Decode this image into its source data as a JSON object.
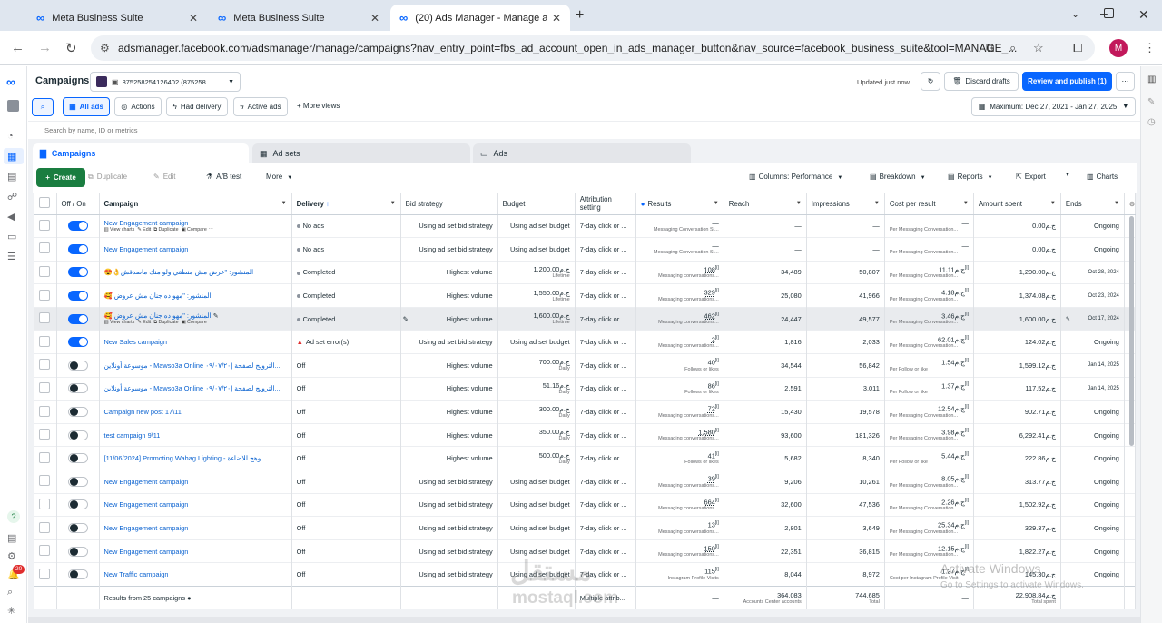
{
  "browser": {
    "tabs": [
      {
        "title": "Meta Business Suite"
      },
      {
        "title": "Meta Business Suite"
      },
      {
        "title": "(20) Ads Manager - Manage ad"
      }
    ],
    "url": "adsmanager.facebook.com/adsmanager/manage/campaigns?nav_entry_point=fbs_ad_account_open_in_ads_manager_button&nav_source=facebook_business_suite&tool=MANAGE_...",
    "profile_initial": "M"
  },
  "rail": {
    "badge": "20"
  },
  "header": {
    "title": "Campaigns",
    "account_label": "875258254126402 (875258...",
    "updated_text": "Updated just now",
    "discard_label": "Discard drafts",
    "review_label": "Review and publish (1)",
    "more_label": "⋯"
  },
  "filters": {
    "all_ads": "All ads",
    "actions": "Actions",
    "had_delivery": "Had delivery",
    "active_ads": "Active ads",
    "more_views": "More views",
    "date_range": "Maximum: Dec 27, 2021 - Jan 27, 2025",
    "search_placeholder": "Search by name, ID or metrics"
  },
  "level_tabs": {
    "campaigns": "Campaigns",
    "ad_sets": "Ad sets",
    "ads": "Ads"
  },
  "toolbar": {
    "create": "Create",
    "duplicate": "Duplicate",
    "edit": "Edit",
    "ab_test": "A/B test",
    "more": "More",
    "columns": "Columns: Performance",
    "breakdown": "Breakdown",
    "reports": "Reports",
    "export": "Export",
    "charts": "Charts"
  },
  "columns": {
    "onoff": "Off / On",
    "campaign": "Campaign",
    "delivery": "Delivery",
    "bid": "Bid strategy",
    "budget": "Budget",
    "attribution": "Attribution setting",
    "results": "Results",
    "reach": "Reach",
    "impressions": "Impressions",
    "cpr": "Cost per result",
    "spent": "Amount spent",
    "ends": "Ends"
  },
  "row_actions": {
    "charts": "View charts",
    "edit": "Edit",
    "duplicate": "Duplicate",
    "compare": "Compare"
  },
  "rows": [
    {
      "on": true,
      "name": "New Engagement campaign",
      "delivery": "No ads",
      "delivery_status": "none",
      "bid": "Using ad set bid strategy",
      "budget": "Using ad set budget",
      "budget_sub": "",
      "attr": "7-day click or ...",
      "results": "—",
      "results_sub": "Messaging Conversation St...",
      "reach": "—",
      "impr": "—",
      "cpr": "—",
      "cpr_sub": "Per Messaging Conversation...",
      "spent": "ج.م0.00",
      "ends": "Ongoing",
      "hover": true
    },
    {
      "on": true,
      "name": "New Engagement campaign",
      "delivery": "No ads",
      "delivery_status": "none",
      "bid": "Using ad set bid strategy",
      "budget": "Using ad set budget",
      "budget_sub": "",
      "attr": "7-day click or ...",
      "results": "—",
      "results_sub": "Messaging Conversation St...",
      "reach": "—",
      "impr": "—",
      "cpr": "—",
      "cpr_sub": "Per Messaging Conversation...",
      "spent": "ج.م0.00",
      "ends": "Ongoing"
    },
    {
      "on": true,
      "name": "😍👌المنشور: \"عرض مش منطقي ولو منك ماصدقش",
      "delivery": "Completed",
      "delivery_status": "done",
      "bid": "Highest volume",
      "budget": "ج.م1,200.00",
      "budget_sub": "Lifetime",
      "attr": "7-day click or ...",
      "results": "108",
      "results_sub": "Messaging conversations...",
      "reach": "34,489",
      "impr": "50,807",
      "cpr": "ج.م11.11",
      "cpr_sub": "Per Messaging Conversation...",
      "spent": "ج.م1,200.00",
      "ends": "Oct 28, 2024"
    },
    {
      "on": true,
      "name": "🥰 المنشور: \"مهو ده جنان مش عروض",
      "delivery": "Completed",
      "delivery_status": "done",
      "bid": "Highest volume",
      "budget": "ج.م1,550.00",
      "budget_sub": "Lifetime",
      "attr": "7-day click or ...",
      "results": "329",
      "results_sub": "Messaging conversations...",
      "reach": "25,080",
      "impr": "41,966",
      "cpr": "ج.م4.18",
      "cpr_sub": "Per Messaging Conversation...",
      "spent": "ج.م1,374.08",
      "ends": "Oct 23, 2024"
    },
    {
      "on": true,
      "name": "🥰 المنشور: \"مهو ده جنان مش عروض",
      "delivery": "Completed",
      "delivery_status": "done",
      "bid": "Highest volume",
      "budget": "ج.م1,600.00",
      "budget_sub": "Lifetime",
      "attr": "7-day click or ...",
      "results": "462",
      "results_sub": "Messaging conversations...",
      "reach": "24,447",
      "impr": "49,577",
      "cpr": "ج.م3.46",
      "cpr_sub": "Per Messaging Conversation...",
      "spent": "ج.م1,600.00",
      "ends": "Oct 17, 2024",
      "hover": true,
      "selected": true
    },
    {
      "on": true,
      "name": "New Sales campaign",
      "delivery": "Ad set error(s)",
      "delivery_status": "error",
      "bid": "Using ad set bid strategy",
      "budget": "Using ad set budget",
      "budget_sub": "",
      "attr": "7-day click or ...",
      "results": "2",
      "results_sub": "Messaging conversations...",
      "reach": "1,816",
      "impr": "2,033",
      "cpr": "ج.م62.01",
      "cpr_sub": "Per Messaging Conversation...",
      "spent": "ج.م124.02",
      "ends": "Ongoing"
    },
    {
      "on": false,
      "name": "موسوعة أونلاين - Mawso3a Online الترويج لصفحة [٠٩/٠٧/٢٠...",
      "delivery": "Off",
      "delivery_status": "off",
      "bid": "Highest volume",
      "budget": "ج.م700.00",
      "budget_sub": "Daily",
      "attr": "7-day click or ...",
      "results": "40",
      "results_sub": "Follows or likes",
      "reach": "34,544",
      "impr": "56,842",
      "cpr": "ج.م1.54",
      "cpr_sub": "Per Follow or like",
      "spent": "ج.م1,599.12",
      "ends": "Jan 14, 2025"
    },
    {
      "on": false,
      "name": "موسوعة أونلاين - Mawso3a Online الترويج لصفحة [٠٩/٠٧/٢٠...",
      "delivery": "Off",
      "delivery_status": "off",
      "bid": "Highest volume",
      "budget": "ج.م51.16",
      "budget_sub": "Daily",
      "attr": "7-day click or ...",
      "results": "86",
      "results_sub": "Follows or likes",
      "reach": "2,591",
      "impr": "3,011",
      "cpr": "ج.م1.37",
      "cpr_sub": "Per Follow or like",
      "spent": "ج.م117.52",
      "ends": "Jan 14, 2025"
    },
    {
      "on": false,
      "name": "Campaign new post 17\\11",
      "delivery": "Off",
      "delivery_status": "off",
      "bid": "Highest volume",
      "budget": "ج.م300.00",
      "budget_sub": "Daily",
      "attr": "7-day click or ...",
      "results": "72",
      "results_sub": "Messaging conversations...",
      "reach": "15,430",
      "impr": "19,578",
      "cpr": "ج.م12.54",
      "cpr_sub": "Per Messaging Conversation...",
      "spent": "ج.م902.71",
      "ends": "Ongoing"
    },
    {
      "on": false,
      "name": "test campaign 9\\11",
      "delivery": "Off",
      "delivery_status": "off",
      "bid": "Highest volume",
      "budget": "ج.م350.00",
      "budget_sub": "Daily",
      "attr": "7-day click or ...",
      "results": "1,580",
      "results_sub": "Messaging conversations...",
      "reach": "93,600",
      "impr": "181,326",
      "cpr": "ج.م3.98",
      "cpr_sub": "Per Messaging Conversation...",
      "spent": "ج.م6,292.41",
      "ends": "Ongoing"
    },
    {
      "on": false,
      "name": "[11/06/2024] Promoting Wahag Lighting - وهج للاضاءة",
      "delivery": "Off",
      "delivery_status": "off",
      "bid": "Highest volume",
      "budget": "ج.م500.00",
      "budget_sub": "Daily",
      "attr": "7-day click or ...",
      "results": "41",
      "results_sub": "Follows or likes",
      "reach": "5,682",
      "impr": "8,340",
      "cpr": "ج.م5.44",
      "cpr_sub": "Per Follow or like",
      "spent": "ج.م222.86",
      "ends": "Ongoing"
    },
    {
      "on": false,
      "name": "New Engagement campaign",
      "delivery": "Off",
      "delivery_status": "off",
      "bid": "Using ad set bid strategy",
      "budget": "Using ad set budget",
      "budget_sub": "",
      "attr": "7-day click or ...",
      "results": "39",
      "results_sub": "Messaging conversations...",
      "reach": "9,206",
      "impr": "10,261",
      "cpr": "ج.م8.05",
      "cpr_sub": "Per Messaging Conversation...",
      "spent": "ج.م313.77",
      "ends": "Ongoing"
    },
    {
      "on": false,
      "name": "New Engagement campaign",
      "delivery": "Off",
      "delivery_status": "off",
      "bid": "Using ad set bid strategy",
      "budget": "Using ad set budget",
      "budget_sub": "",
      "attr": "7-day click or ...",
      "results": "664",
      "results_sub": "Messaging conversations...",
      "reach": "32,600",
      "impr": "47,536",
      "cpr": "ج.م2.26",
      "cpr_sub": "Per Messaging Conversation...",
      "spent": "ج.م1,502.92",
      "ends": "Ongoing"
    },
    {
      "on": false,
      "name": "New Engagement campaign",
      "delivery": "Off",
      "delivery_status": "off",
      "bid": "Using ad set bid strategy",
      "budget": "Using ad set budget",
      "budget_sub": "",
      "attr": "7-day click or ...",
      "results": "13",
      "results_sub": "Messaging conversations...",
      "reach": "2,801",
      "impr": "3,649",
      "cpr": "ج.م25.34",
      "cpr_sub": "Per Messaging Conversation...",
      "spent": "ج.م329.37",
      "ends": "Ongoing"
    },
    {
      "on": false,
      "name": "New Engagement campaign",
      "delivery": "Off",
      "delivery_status": "off",
      "bid": "Using ad set bid strategy",
      "budget": "Using ad set budget",
      "budget_sub": "",
      "attr": "7-day click or ...",
      "results": "150",
      "results_sub": "Messaging conversations...",
      "reach": "22,351",
      "impr": "36,815",
      "cpr": "ج.م12.15",
      "cpr_sub": "Per Messaging Conversation...",
      "spent": "ج.م1,822.27",
      "ends": "Ongoing"
    },
    {
      "on": false,
      "name": "New Traffic campaign",
      "delivery": "Off",
      "delivery_status": "off",
      "bid": "Using ad set bid strategy",
      "budget": "Using ad set budget",
      "budget_sub": "",
      "attr": "7-day click or ...",
      "results": "115",
      "results_sub": "Instagram Profile Visits",
      "reach": "8,044",
      "impr": "8,972",
      "cpr": "ج.م1.27",
      "cpr_sub": "Cost per Instagram Profile Visit",
      "spent": "ج.م145.30",
      "ends": "Ongoing"
    }
  ],
  "footer": {
    "label": "Results from 25 campaigns",
    "attr": "Multiple attrib...",
    "results": "—",
    "reach": "364,083",
    "reach_sub": "Accounts Center accounts",
    "impr": "744,685",
    "impr_sub": "Total",
    "cpr": "—",
    "spent": "ج.م22,908.84",
    "spent_sub": "Total spent"
  },
  "watermark": {
    "logo": "مستقل",
    "site": "mostaql.com",
    "activate_1": "Activate Windows",
    "activate_2": "Go to Settings to activate Windows."
  },
  "colors": {
    "accent": "#0866ff",
    "create": "#1a7d40",
    "error": "#e02d2d"
  }
}
